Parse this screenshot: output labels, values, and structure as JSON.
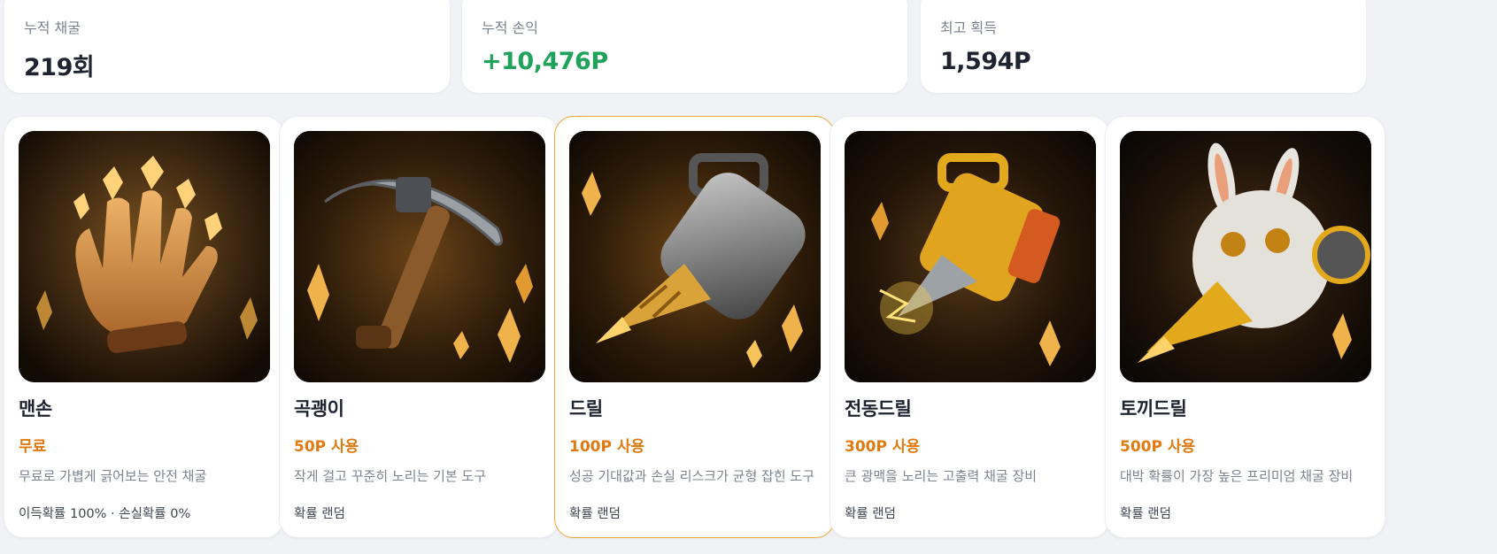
{
  "stats": [
    {
      "label": "누적 채굴",
      "value": "219회",
      "kind": "plain"
    },
    {
      "label": "누적 손익",
      "value": "+10,476P",
      "kind": "profit"
    },
    {
      "label": "최고 획득",
      "value": "1,594P",
      "kind": "plain"
    }
  ],
  "tools": [
    {
      "name": "맨손",
      "cost": "무료",
      "desc": "무료로 가볍게 긁어보는 안전 채굴",
      "prob": "이득확률 100% · 손실확률 0%",
      "icon": "glove-icon",
      "selected": false
    },
    {
      "name": "곡괭이",
      "cost": "50P 사용",
      "desc": "작게 걸고 꾸준히 노리는 기본 도구",
      "prob": "확률 랜덤",
      "icon": "pickaxe-icon",
      "selected": false
    },
    {
      "name": "드릴",
      "cost": "100P 사용",
      "desc": "성공 기대값과 손실 리스크가 균형 잡힌 도구",
      "prob": "확률 랜덤",
      "icon": "drill-icon",
      "selected": true
    },
    {
      "name": "전동드릴",
      "cost": "300P 사용",
      "desc": "큰 광맥을 노리는 고출력 채굴 장비",
      "prob": "확률 랜덤",
      "icon": "power-drill-icon",
      "selected": false
    },
    {
      "name": "토끼드릴",
      "cost": "500P 사용",
      "desc": "대박 확률이 가장 높은 프리미엄 채굴 장비",
      "prob": "확률 랜덤",
      "icon": "rabbit-drill-icon",
      "selected": false
    }
  ],
  "colors": {
    "accent": "#e07a10",
    "profit": "#1fa25a",
    "selected_border": "#f2a93b"
  }
}
